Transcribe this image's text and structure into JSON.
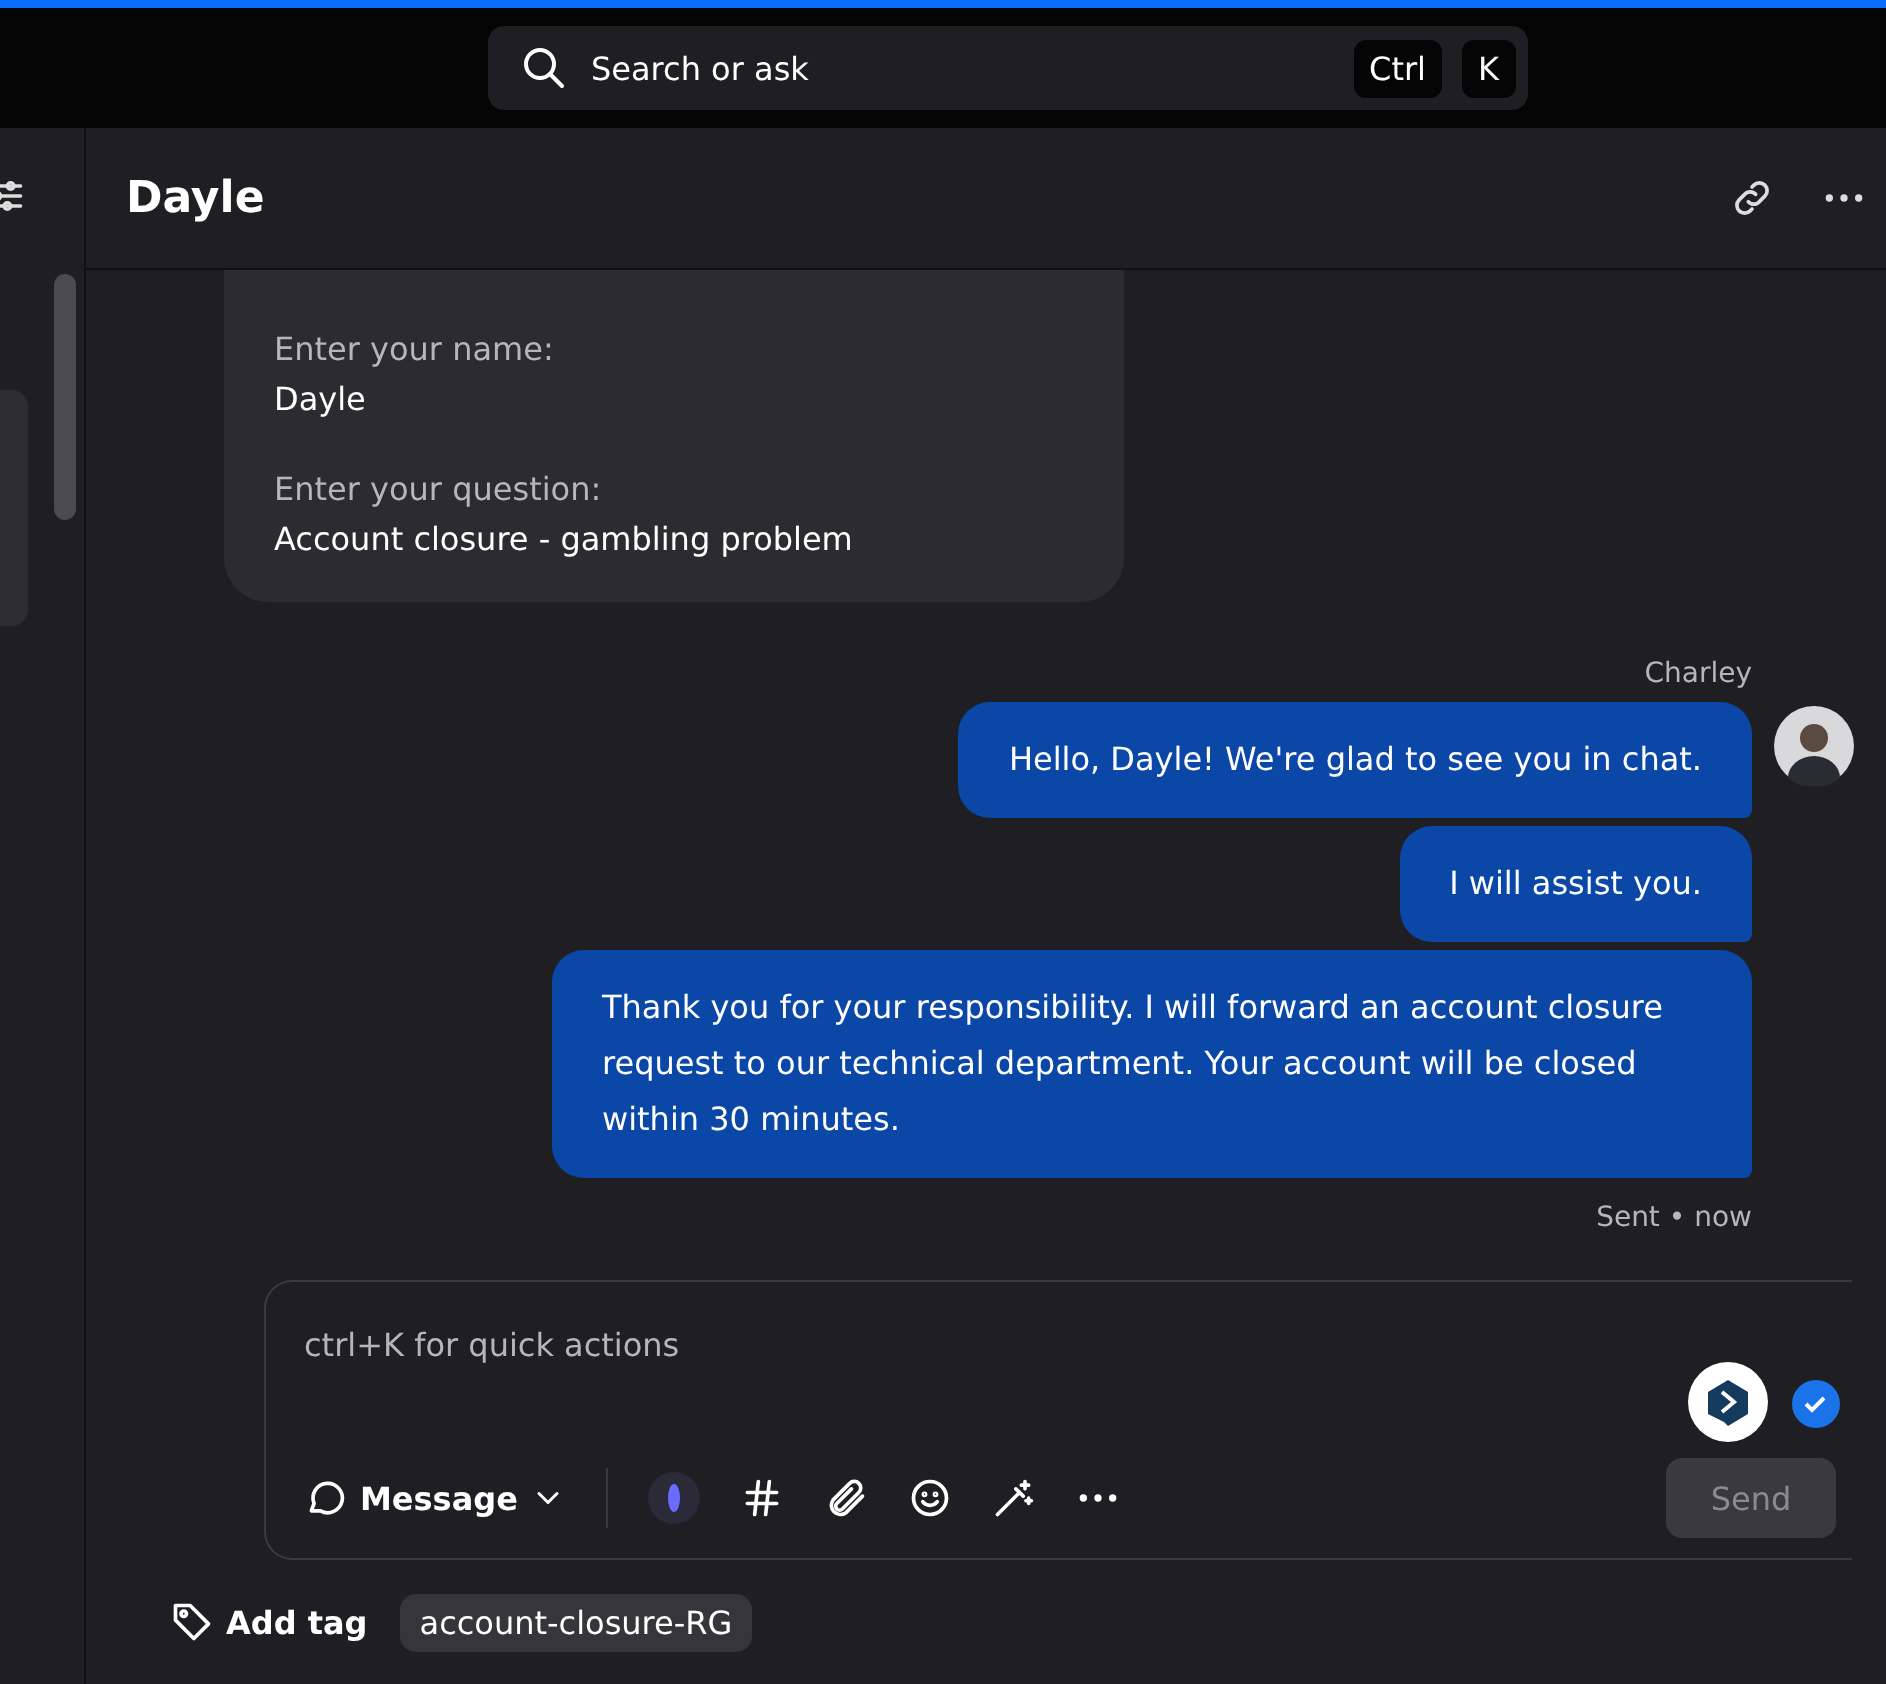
{
  "search": {
    "placeholder": "Search or ask",
    "keys": [
      "Ctrl",
      "K"
    ]
  },
  "conversation": {
    "title": "Dayle"
  },
  "form_card": {
    "fields": [
      {
        "label": "Enter your name:",
        "value": "Dayle"
      },
      {
        "label": "Enter your question:",
        "value": "Account closure - gambling problem"
      }
    ]
  },
  "messages": {
    "sender": "Charley",
    "bubbles": [
      "Hello, Dayle! We're glad to see you in chat.",
      "I will assist you.",
      "Thank you for your responsibility. I will forward an account closure request to our technical department. Your account will be closed within 30 minutes."
    ],
    "status": "Sent",
    "separator": "•",
    "time": "now"
  },
  "composer": {
    "placeholder": "ctrl+K for quick actions",
    "mode": "Message",
    "send": "Send",
    "send_disabled": true
  },
  "tags": {
    "add_label": "Add tag",
    "items": [
      "account-closure-RG"
    ]
  }
}
